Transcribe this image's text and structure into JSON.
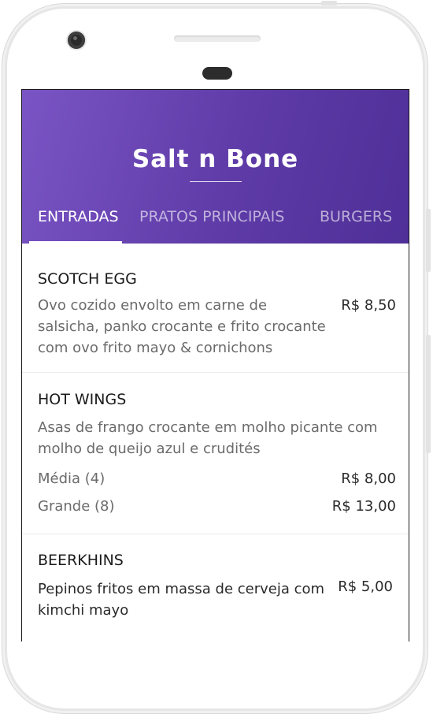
{
  "app": {
    "title": "Salt n Bone"
  },
  "tabs": [
    {
      "label": "ENTRADAS",
      "active": true
    },
    {
      "label": "PRATOS PRINCIPAIS",
      "active": false
    },
    {
      "label": "BURGERS",
      "active": false
    }
  ],
  "menu": [
    {
      "name": "SCOTCH EGG",
      "description": "Ovo cozido envolto em carne de salsicha, panko crocante e frito crocante com ovo frito mayo & cornichons",
      "price": "R$ 8,50"
    },
    {
      "name": "HOT WINGS",
      "description": "Asas de frango crocante em molho picante com molho de queijo azul e crudités",
      "variants": [
        {
          "label": "Média (4)",
          "price": "R$ 8,00"
        },
        {
          "label": "Grande (8)",
          "price": "R$ 13,00"
        }
      ]
    },
    {
      "name": "BEERKHINS",
      "description": "Pepinos fritos em massa de cerveja com kimchi mayo",
      "price": "R$ 5,00"
    }
  ],
  "colors": {
    "header_start": "#7a54c4",
    "header_end": "#4f2f98",
    "tab_active": "#ffffff",
    "tab_inactive": "rgba(255,255,255,0.6)"
  }
}
